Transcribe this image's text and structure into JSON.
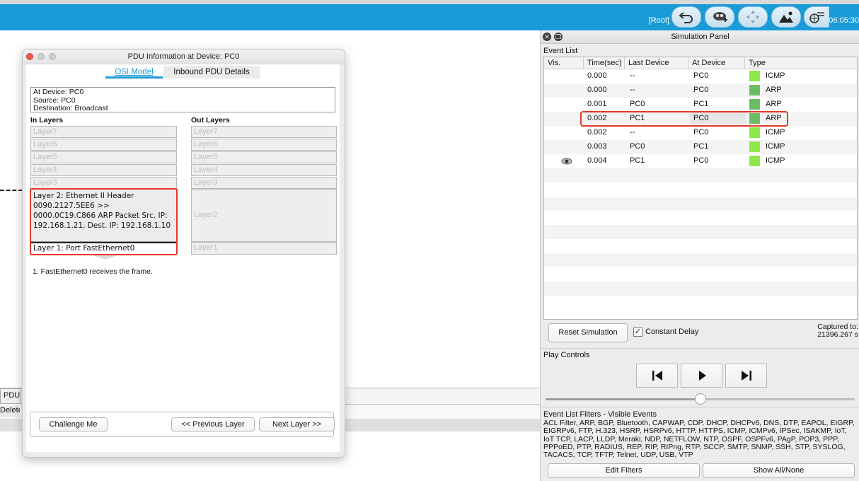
{
  "toolbar": {
    "root_label": "[Root]",
    "clock": "06:05:30",
    "icons": [
      "back-arrow-icon",
      "cloud-cluster-icon",
      "move-icon",
      "landscape-icon",
      "viewport-icon"
    ]
  },
  "workspace": {
    "pdu_tab": "PDU",
    "delete_label": "Delete"
  },
  "pdu_dialog": {
    "title": "PDU Information at Device: PC0",
    "tabs": [
      "OSI Model",
      "Inbound PDU Details"
    ],
    "info": {
      "at_device": "At Device: PC0",
      "source": "Source: PC0",
      "destination": "Destination: Broadcast"
    },
    "in_layers_title": "In Layers",
    "out_layers_title": "Out Layers",
    "in_layers": {
      "l7": "Layer7",
      "l6": "Layer6",
      "l5": "Layer5",
      "l4": "Layer4",
      "l3": "Layer3",
      "l2": "Layer 2: Ethernet II Header 0090.2127.5EE6 >> 0000.0C19.C866 ARP Packet Src. IP: 192.168.1.21, Dest. IP: 192.168.1.10",
      "l1": "Layer 1: Port FastEthernet0"
    },
    "out_layers": {
      "l7": "Layer7",
      "l6": "Layer6",
      "l5": "Layer5",
      "l4": "Layer4",
      "l3": "Layer3",
      "l2": "Layer2",
      "l1": "Layer1"
    },
    "step": "1. FastEthernet0 receives the frame.",
    "buttons": {
      "challenge": "Challenge Me",
      "prev": "<< Previous Layer",
      "next": "Next Layer >>"
    }
  },
  "simulation_panel": {
    "title": "Simulation Panel",
    "event_list_label": "Event List",
    "columns": [
      "Vis.",
      "Time(sec)",
      "Last Device",
      "At Device",
      "Type"
    ],
    "events": [
      {
        "time": "0.000",
        "last": "--",
        "at": "PC0",
        "type": "ICMP",
        "color": "#8fe84a"
      },
      {
        "time": "0.000",
        "last": "--",
        "at": "PC0",
        "type": "ARP",
        "color": "#6bbd63"
      },
      {
        "time": "0.001",
        "last": "PC0",
        "at": "PC1",
        "type": "ARP",
        "color": "#6bbd63"
      },
      {
        "time": "0.002",
        "last": "PC1",
        "at": "PC0",
        "type": "ARP",
        "color": "#6bbd63"
      },
      {
        "time": "0.002",
        "last": "--",
        "at": "PC0",
        "type": "ICMP",
        "color": "#8fe84a"
      },
      {
        "time": "0.003",
        "last": "PC0",
        "at": "PC1",
        "type": "ICMP",
        "color": "#8fe84a"
      },
      {
        "time": "0.004",
        "last": "PC1",
        "at": "PC0",
        "type": "ICMP",
        "color": "#8fe84a"
      }
    ],
    "reset_button": "Reset Simulation",
    "constant_delay_label": "Constant Delay",
    "constant_delay_checked": "✓",
    "captured_line1": "Captured to:",
    "captured_line2": "21396.267 s",
    "play_controls_label": "Play Controls",
    "slider_position": 0.5,
    "filters_label": "Event List Filters - Visible Events",
    "filters_text": "ACL Filter, ARP, BGP, Bluetooth, CAPWAP, CDP, DHCP, DHCPv6, DNS, DTP, EAPOL, EIGRP, EIGRPv6, FTP, H.323, HSRP, HSRPv6, HTTP, HTTPS, ICMP, ICMPv6, IPSec, ISAKMP, IoT, IoT TCP, LACP, LLDP, Meraki, NDP, NETFLOW, NTP, OSPF, OSPFv6, PAgP, POP3, PPP, PPPoED, PTP, RADIUS, REP, RIP, RIPng, RTP, SCCP, SMTP, SNMP, SSH, STP, SYSLOG, TACACS, TCP, TFTP, Telnet, UDP, USB, VTP",
    "edit_filters": "Edit Filters",
    "show_all": "Show All/None"
  }
}
